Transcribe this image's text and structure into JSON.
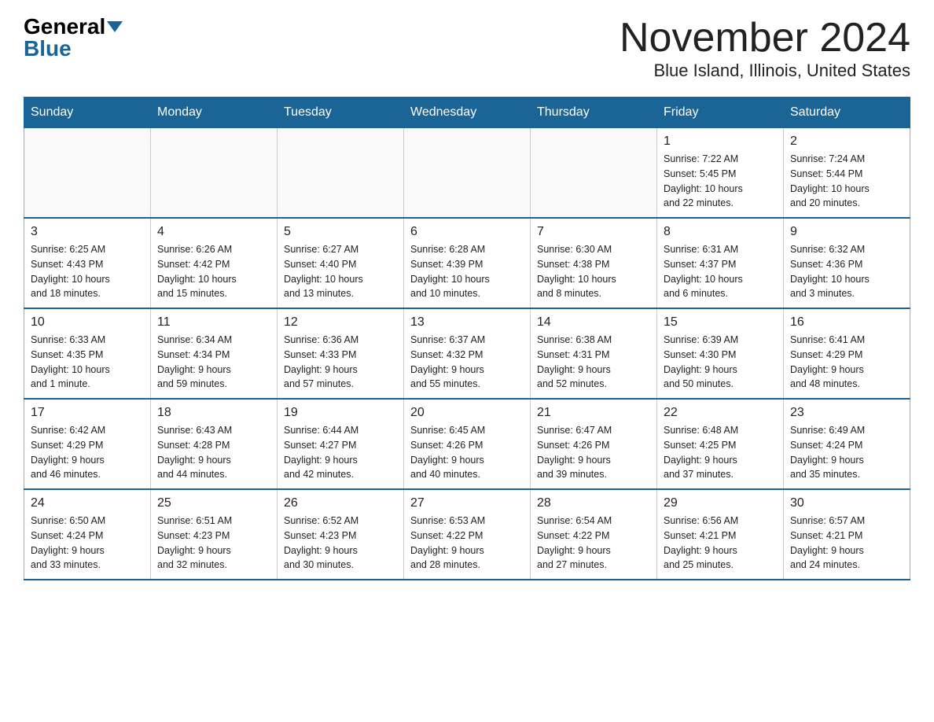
{
  "logo": {
    "general": "General",
    "blue": "Blue"
  },
  "title": "November 2024",
  "location": "Blue Island, Illinois, United States",
  "days_of_week": [
    "Sunday",
    "Monday",
    "Tuesday",
    "Wednesday",
    "Thursday",
    "Friday",
    "Saturday"
  ],
  "weeks": [
    [
      {
        "day": "",
        "info": ""
      },
      {
        "day": "",
        "info": ""
      },
      {
        "day": "",
        "info": ""
      },
      {
        "day": "",
        "info": ""
      },
      {
        "day": "",
        "info": ""
      },
      {
        "day": "1",
        "info": "Sunrise: 7:22 AM\nSunset: 5:45 PM\nDaylight: 10 hours\nand 22 minutes."
      },
      {
        "day": "2",
        "info": "Sunrise: 7:24 AM\nSunset: 5:44 PM\nDaylight: 10 hours\nand 20 minutes."
      }
    ],
    [
      {
        "day": "3",
        "info": "Sunrise: 6:25 AM\nSunset: 4:43 PM\nDaylight: 10 hours\nand 18 minutes."
      },
      {
        "day": "4",
        "info": "Sunrise: 6:26 AM\nSunset: 4:42 PM\nDaylight: 10 hours\nand 15 minutes."
      },
      {
        "day": "5",
        "info": "Sunrise: 6:27 AM\nSunset: 4:40 PM\nDaylight: 10 hours\nand 13 minutes."
      },
      {
        "day": "6",
        "info": "Sunrise: 6:28 AM\nSunset: 4:39 PM\nDaylight: 10 hours\nand 10 minutes."
      },
      {
        "day": "7",
        "info": "Sunrise: 6:30 AM\nSunset: 4:38 PM\nDaylight: 10 hours\nand 8 minutes."
      },
      {
        "day": "8",
        "info": "Sunrise: 6:31 AM\nSunset: 4:37 PM\nDaylight: 10 hours\nand 6 minutes."
      },
      {
        "day": "9",
        "info": "Sunrise: 6:32 AM\nSunset: 4:36 PM\nDaylight: 10 hours\nand 3 minutes."
      }
    ],
    [
      {
        "day": "10",
        "info": "Sunrise: 6:33 AM\nSunset: 4:35 PM\nDaylight: 10 hours\nand 1 minute."
      },
      {
        "day": "11",
        "info": "Sunrise: 6:34 AM\nSunset: 4:34 PM\nDaylight: 9 hours\nand 59 minutes."
      },
      {
        "day": "12",
        "info": "Sunrise: 6:36 AM\nSunset: 4:33 PM\nDaylight: 9 hours\nand 57 minutes."
      },
      {
        "day": "13",
        "info": "Sunrise: 6:37 AM\nSunset: 4:32 PM\nDaylight: 9 hours\nand 55 minutes."
      },
      {
        "day": "14",
        "info": "Sunrise: 6:38 AM\nSunset: 4:31 PM\nDaylight: 9 hours\nand 52 minutes."
      },
      {
        "day": "15",
        "info": "Sunrise: 6:39 AM\nSunset: 4:30 PM\nDaylight: 9 hours\nand 50 minutes."
      },
      {
        "day": "16",
        "info": "Sunrise: 6:41 AM\nSunset: 4:29 PM\nDaylight: 9 hours\nand 48 minutes."
      }
    ],
    [
      {
        "day": "17",
        "info": "Sunrise: 6:42 AM\nSunset: 4:29 PM\nDaylight: 9 hours\nand 46 minutes."
      },
      {
        "day": "18",
        "info": "Sunrise: 6:43 AM\nSunset: 4:28 PM\nDaylight: 9 hours\nand 44 minutes."
      },
      {
        "day": "19",
        "info": "Sunrise: 6:44 AM\nSunset: 4:27 PM\nDaylight: 9 hours\nand 42 minutes."
      },
      {
        "day": "20",
        "info": "Sunrise: 6:45 AM\nSunset: 4:26 PM\nDaylight: 9 hours\nand 40 minutes."
      },
      {
        "day": "21",
        "info": "Sunrise: 6:47 AM\nSunset: 4:26 PM\nDaylight: 9 hours\nand 39 minutes."
      },
      {
        "day": "22",
        "info": "Sunrise: 6:48 AM\nSunset: 4:25 PM\nDaylight: 9 hours\nand 37 minutes."
      },
      {
        "day": "23",
        "info": "Sunrise: 6:49 AM\nSunset: 4:24 PM\nDaylight: 9 hours\nand 35 minutes."
      }
    ],
    [
      {
        "day": "24",
        "info": "Sunrise: 6:50 AM\nSunset: 4:24 PM\nDaylight: 9 hours\nand 33 minutes."
      },
      {
        "day": "25",
        "info": "Sunrise: 6:51 AM\nSunset: 4:23 PM\nDaylight: 9 hours\nand 32 minutes."
      },
      {
        "day": "26",
        "info": "Sunrise: 6:52 AM\nSunset: 4:23 PM\nDaylight: 9 hours\nand 30 minutes."
      },
      {
        "day": "27",
        "info": "Sunrise: 6:53 AM\nSunset: 4:22 PM\nDaylight: 9 hours\nand 28 minutes."
      },
      {
        "day": "28",
        "info": "Sunrise: 6:54 AM\nSunset: 4:22 PM\nDaylight: 9 hours\nand 27 minutes."
      },
      {
        "day": "29",
        "info": "Sunrise: 6:56 AM\nSunset: 4:21 PM\nDaylight: 9 hours\nand 25 minutes."
      },
      {
        "day": "30",
        "info": "Sunrise: 6:57 AM\nSunset: 4:21 PM\nDaylight: 9 hours\nand 24 minutes."
      }
    ]
  ]
}
